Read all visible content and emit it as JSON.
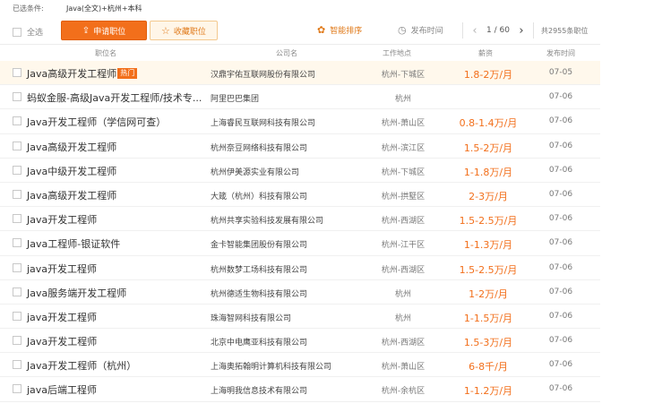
{
  "filter": {
    "label": "已选条件:",
    "value": "Java(全文)+杭州+本科"
  },
  "toolbar": {
    "select_all": "全选",
    "apply_label": "申请职位",
    "apply_icon": "paper-plane-icon",
    "fav_label": "收藏职位",
    "fav_icon": "star-icon",
    "sort_smart": "智能排序",
    "sort_time": "发布时间",
    "accent": "#f26f1b"
  },
  "pager": {
    "current": "1",
    "total": "60",
    "sep": "/"
  },
  "total_text": "共2955条职位",
  "headers": {
    "title": "职位名",
    "company": "公司名",
    "location": "工作地点",
    "salary": "薪资",
    "date": "发布时间"
  },
  "hot_badge": "热门",
  "jobs": [
    {
      "title": "Java高级开发工程师",
      "company": "汉鼎宇佑互联网股份有限公司",
      "location": "杭州-下城区",
      "salary": "1.8-2万/月",
      "date": "07-05"
    },
    {
      "title": "蚂蚁金服-高级Java开发工程师/技术专...",
      "company": "阿里巴巴集团",
      "location": "杭州",
      "salary": "",
      "date": "07-06"
    },
    {
      "title": "Java开发工程师（学信网可查）",
      "company": "上海睿民互联网科技有限公司",
      "location": "杭州-萧山区",
      "salary": "0.8-1.4万/月",
      "date": "07-06"
    },
    {
      "title": "Java高级开发工程师",
      "company": "杭州奈豆网络科技有限公司",
      "location": "杭州-滨江区",
      "salary": "1.5-2万/月",
      "date": "07-06"
    },
    {
      "title": "Java中级开发工程师",
      "company": "杭州伊美源实业有限公司",
      "location": "杭州-下城区",
      "salary": "1-1.8万/月",
      "date": "07-06"
    },
    {
      "title": "Java高级开发工程师",
      "company": "大箴（杭州）科技有限公司",
      "location": "杭州-拱墅区",
      "salary": "2-3万/月",
      "date": "07-06"
    },
    {
      "title": "Java开发工程师",
      "company": "杭州共享实验科技发展有限公司",
      "location": "杭州-西湖区",
      "salary": "1.5-2.5万/月",
      "date": "07-06"
    },
    {
      "title": "Java工程师-银证软件",
      "company": "金卡智能集团股份有限公司",
      "location": "杭州-江干区",
      "salary": "1-1.3万/月",
      "date": "07-06"
    },
    {
      "title": "java开发工程师",
      "company": "杭州数梦工场科技有限公司",
      "location": "杭州-西湖区",
      "salary": "1.5-2.5万/月",
      "date": "07-06"
    },
    {
      "title": "Java服务端开发工程师",
      "company": "杭州德适生物科技有限公司",
      "location": "杭州",
      "salary": "1-2万/月",
      "date": "07-06"
    },
    {
      "title": "java开发工程师",
      "company": "珠海智网科技有限公司",
      "location": "杭州",
      "salary": "1-1.5万/月",
      "date": "07-06"
    },
    {
      "title": "Java开发工程师",
      "company": "北京中电鹰亚科技有限公司",
      "location": "杭州-西湖区",
      "salary": "1.5-3万/月",
      "date": "07-06"
    },
    {
      "title": "Java开发工程师（杭州）",
      "company": "上海奥拓翰明计算机科技有限公司",
      "location": "杭州-萧山区",
      "salary": "6-8千/月",
      "date": "07-06"
    },
    {
      "title": "java后端工程师",
      "company": "上海明我信息技术有限公司",
      "location": "杭州-余杭区",
      "salary": "1-1.2万/月",
      "date": "07-06"
    }
  ]
}
